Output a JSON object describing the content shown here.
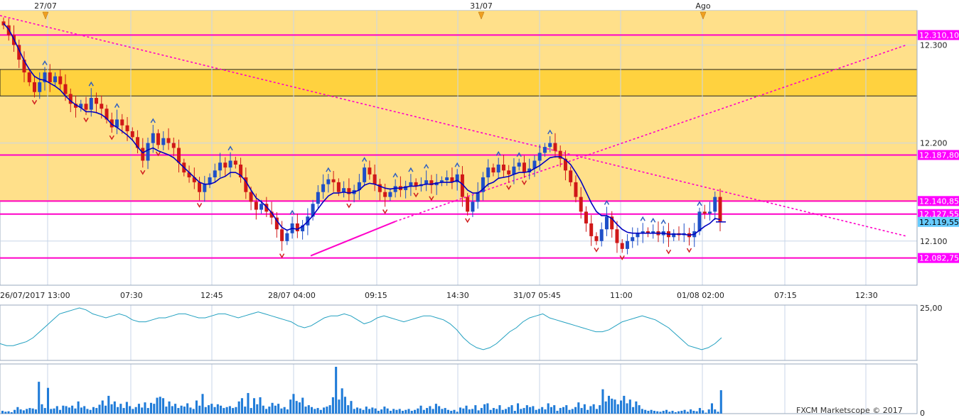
{
  "colors": {
    "zone_fill": "#FFE08A",
    "zone_band": "#FFD23F",
    "level_line": "#FF00C8",
    "ema_line": "#0000C0",
    "up_candle": "#1E4FC8",
    "down_candle": "#D01818",
    "osc_line": "#22A0C0",
    "volume_bar": "#1F7BD8",
    "grid": "#C8D6E8",
    "current_price_bg": "#66CCFF",
    "level_label_bg": "#FF00FF"
  },
  "top_markers": [
    "27/07",
    "31/07",
    "Ago"
  ],
  "x_axis_labels": [
    "26/07/2017 13:00",
    "07:30",
    "12:45",
    "28/07 04:00",
    "09:15",
    "14:30",
    "31/07 05:45",
    "11:00",
    "01/08 02:00",
    "07:15",
    "12:30"
  ],
  "y_axis_labels": [
    "12.300",
    "12.200",
    "12.100"
  ],
  "level_labels": [
    "12.310,10",
    "12.187,80",
    "12.140,85",
    "12.127,55",
    "12.082,75"
  ],
  "current_price": "12.119,55",
  "osc_axis": {
    "top_label": "25,00"
  },
  "vol_axis": {
    "bottom_label": "0"
  },
  "copyright": "FXCM Marketscope © 2017",
  "chart_data": [
    {
      "type": "candlestick",
      "ylim": [
        12.055,
        12.335
      ],
      "grid": true,
      "zone": {
        "from": 12.14,
        "to": 12.335
      },
      "band": {
        "from": 12.248,
        "to": 12.275
      },
      "levels": [
        12.3101,
        12.1878,
        12.14085,
        12.12755,
        12.08275
      ],
      "current": 12.11955,
      "series": [
        {
          "name": "price",
          "close": [
            12.32,
            12.31,
            12.3,
            12.285,
            12.272,
            12.262,
            12.252,
            12.262,
            12.272,
            12.262,
            12.268,
            12.26,
            12.25,
            12.24,
            12.236,
            12.24,
            12.234,
            12.246,
            12.24,
            12.235,
            12.224,
            12.216,
            12.224,
            12.218,
            12.212,
            12.206,
            12.195,
            12.182,
            12.2,
            12.21,
            12.198,
            12.205,
            12.2,
            12.195,
            12.18,
            12.17,
            12.165,
            12.16,
            12.15,
            12.158,
            12.165,
            12.172,
            12.18,
            12.175,
            12.182,
            12.178,
            12.165,
            12.15,
            12.14,
            12.132,
            12.138,
            12.13,
            12.124,
            12.112,
            12.1,
            12.108,
            12.118,
            12.11,
            12.116,
            12.125,
            12.138,
            12.15,
            12.158,
            12.163,
            12.16,
            12.15,
            12.154,
            12.148,
            12.152,
            12.16,
            12.175,
            12.168,
            12.158,
            12.15,
            12.145,
            12.15,
            12.156,
            12.152,
            12.156,
            12.16,
            12.156,
            12.158,
            12.162,
            12.157,
            12.16,
            12.162,
            12.165,
            12.16,
            12.168,
            12.145,
            12.13,
            12.14,
            12.15,
            12.165,
            12.175,
            12.17,
            12.178,
            12.172,
            12.168,
            12.176,
            12.18,
            12.17,
            12.174,
            12.182,
            12.19,
            12.196,
            12.2,
            12.192,
            12.184,
            12.172,
            12.16,
            12.145,
            12.13,
            12.118,
            12.105,
            12.1,
            12.112,
            12.125,
            12.112,
            12.098,
            12.092,
            12.1,
            12.104,
            12.108,
            12.11,
            12.108,
            12.11,
            12.106,
            12.11,
            12.104,
            12.108,
            12.106,
            12.108,
            12.104,
            12.11,
            12.13,
            12.128,
            12.13,
            12.145,
            12.12
          ]
        },
        {
          "name": "ema",
          "values": [
            12.322,
            12.316,
            12.306,
            12.295,
            12.284,
            12.275,
            12.268,
            12.265,
            12.264,
            12.261,
            12.258,
            12.254,
            12.248,
            12.243,
            12.239,
            12.236,
            12.232,
            12.232,
            12.231,
            12.229,
            12.225,
            12.219,
            12.216,
            12.212,
            12.208,
            12.203,
            12.196,
            12.19,
            12.193,
            12.195,
            12.192,
            12.19,
            12.188,
            12.185,
            12.18,
            12.175,
            12.17,
            12.165,
            12.16,
            12.158,
            12.158,
            12.16,
            12.164,
            12.166,
            12.17,
            12.17,
            12.167,
            12.161,
            12.152,
            12.144,
            12.14,
            12.135,
            12.129,
            12.121,
            12.114,
            12.111,
            12.113,
            12.112,
            12.115,
            12.12,
            12.126,
            12.133,
            12.14,
            12.146,
            12.149,
            12.149,
            12.15,
            12.149,
            12.15,
            12.152,
            12.157,
            12.159,
            12.158,
            12.156,
            12.154,
            12.153,
            12.154,
            12.154,
            12.155,
            12.156,
            12.156,
            12.157,
            12.158,
            12.158,
            12.159,
            12.16,
            12.16,
            12.16,
            12.162,
            12.158,
            12.152,
            12.149,
            12.149,
            12.153,
            12.158,
            12.16,
            12.164,
            12.165,
            12.166,
            12.168,
            12.17,
            12.17,
            12.171,
            12.174,
            12.177,
            12.181,
            12.185,
            12.186,
            12.186,
            12.183,
            12.178,
            12.17,
            12.161,
            12.15,
            12.139,
            12.13,
            12.126,
            12.126,
            12.123,
            12.117,
            12.112,
            12.109,
            12.108,
            12.108,
            12.108,
            12.108,
            12.108,
            12.108,
            12.108,
            12.107,
            12.107,
            12.107,
            12.107,
            12.106,
            12.107,
            12.111,
            12.115,
            12.118,
            12.123,
            12.122
          ]
        }
      ],
      "trendlines": [
        {
          "x": [
            0,
            1275
          ],
          "y": [
            12.33,
            12.105
          ],
          "style": "dotted"
        },
        {
          "x": [
            437,
            556
          ],
          "y": [
            12.085,
            12.12
          ],
          "style": "solid"
        },
        {
          "x": [
            556,
            1275
          ],
          "y": [
            12.12,
            12.3
          ],
          "style": "dotted"
        }
      ]
    },
    {
      "type": "line",
      "name": "oscillator",
      "ylim": [
        0,
        25
      ],
      "values": [
        7,
        6,
        6,
        7,
        8,
        10,
        13,
        16,
        19,
        22,
        23,
        24,
        25,
        24,
        22,
        21,
        20,
        21,
        22,
        21,
        19,
        18,
        18,
        19,
        20,
        20,
        21,
        22,
        22,
        21,
        20,
        20,
        21,
        22,
        22,
        21,
        20,
        21,
        22,
        23,
        22,
        21,
        20,
        19,
        18,
        16,
        15,
        16,
        18,
        20,
        21,
        21,
        22,
        21,
        19,
        17,
        18,
        20,
        21,
        20,
        19,
        18,
        19,
        20,
        21,
        21,
        20,
        19,
        17,
        14,
        10,
        7,
        5,
        4,
        5,
        7,
        10,
        13,
        15,
        18,
        20,
        21,
        22,
        20,
        19,
        18,
        17,
        16,
        15,
        14,
        13,
        13,
        14,
        16,
        18,
        19,
        20,
        21,
        20,
        19,
        17,
        15,
        12,
        9,
        6,
        5,
        4,
        5,
        7,
        10
      ]
    },
    {
      "type": "bar",
      "name": "volume",
      "ylim": [
        0,
        100
      ],
      "values": [
        6,
        4,
        5,
        3,
        8,
        14,
        9,
        7,
        10,
        12,
        11,
        9,
        68,
        20,
        12,
        55,
        10,
        11,
        16,
        8,
        17,
        16,
        13,
        17,
        11,
        26,
        13,
        16,
        10,
        8,
        14,
        12,
        19,
        28,
        17,
        38,
        20,
        26,
        14,
        21,
        12,
        25,
        16,
        10,
        14,
        21,
        13,
        24,
        12,
        23,
        21,
        34,
        36,
        33,
        15,
        26,
        16,
        21,
        12,
        17,
        15,
        22,
        13,
        10,
        28,
        17,
        42,
        14,
        18,
        21,
        14,
        20,
        17,
        12,
        14,
        16,
        12,
        14,
        26,
        33,
        15,
        44,
        12,
        33,
        20,
        35,
        17,
        10,
        15,
        23,
        17,
        21,
        11,
        14,
        9,
        30,
        42,
        27,
        24,
        34,
        15,
        18,
        14,
        10,
        12,
        8,
        13,
        15,
        18,
        35,
        100,
        30,
        54,
        36,
        18,
        27,
        10,
        13,
        11,
        8,
        15,
        10,
        13,
        11,
        6,
        9,
        15,
        11,
        6,
        10,
        8,
        10,
        6,
        8,
        10,
        6,
        8,
        11,
        17,
        8,
        12,
        16,
        10,
        21,
        16,
        10,
        12,
        8,
        6,
        8,
        4,
        13,
        11,
        17,
        9,
        10,
        18,
        7,
        12,
        20,
        22,
        8,
        12,
        10,
        18,
        8,
        10,
        14,
        18,
        6,
        22,
        10,
        12,
        18,
        14,
        16,
        8,
        10,
        14,
        9,
        22,
        14,
        18,
        6,
        12,
        14,
        18,
        8,
        10,
        14,
        24,
        12,
        20,
        8,
        16,
        20,
        10,
        18,
        52,
        26,
        38,
        32,
        30,
        20,
        28,
        38,
        22,
        30,
        14,
        26,
        18,
        10,
        8,
        6,
        8,
        6,
        5,
        4,
        6,
        8,
        4,
        6,
        3,
        5,
        6,
        8,
        4,
        9,
        6,
        5,
        12,
        7,
        2,
        9,
        22,
        9,
        4,
        50
      ]
    }
  ]
}
